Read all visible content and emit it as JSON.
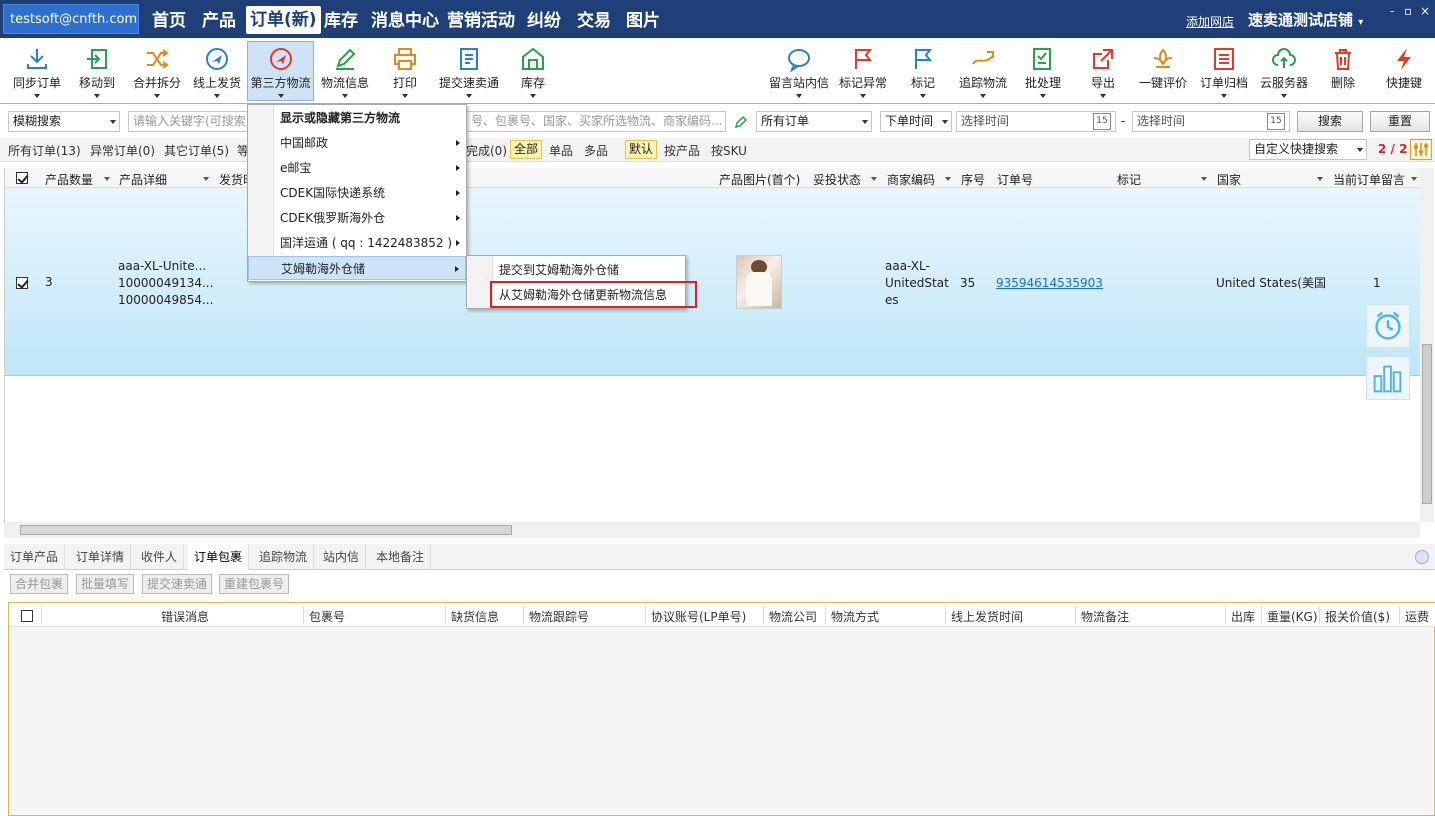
{
  "topbar": {
    "account": "testsoft@cnfth.com",
    "nav": [
      "首页",
      "产品",
      "订单(新)",
      "库存",
      "消息中心",
      "营销活动",
      "纠纷",
      "交易",
      "图片"
    ],
    "add_shop": "添加网店",
    "shop_name": "速卖通测试店铺",
    "win_min": "-",
    "win_max": "▫",
    "win_close": "×"
  },
  "toolbar": {
    "left": [
      "同步订单",
      "移动到",
      "合并拆分",
      "线上发货",
      "第三方物流",
      "物流信息",
      "打印",
      "提交速卖通",
      "库存"
    ],
    "right": [
      "留言站内信",
      "标记异常",
      "标记",
      "追踪物流",
      "批处理",
      "导出",
      "一键评价",
      "订单归档",
      "云服务器",
      "删除",
      "快捷键"
    ]
  },
  "filter": {
    "mode": "模糊搜索",
    "keyword_placeholder": "请输入关键字(可搜索",
    "keyword_hint": "号、包裹号、国家、买家所选物流、商家编码...",
    "order_type": "所有订单",
    "time_type": "下单时间",
    "start_placeholder": "选择时间",
    "dash": "-",
    "end_placeholder": "选择时间",
    "cal": "15",
    "search": "搜索",
    "reset": "重置"
  },
  "tabs": {
    "all": "所有订单(13)",
    "abnormal": "异常订单(0)",
    "other": "其它订单(5)",
    "wait": "等",
    "done": "完成(0)",
    "pills": [
      "全部",
      "单品",
      "多品"
    ],
    "pills2": [
      "默认",
      "按产品",
      "按SKU"
    ],
    "quick_search": "自定义快捷搜索",
    "page": "2 / 2"
  },
  "grid": {
    "headers": [
      "产品数量",
      "产品详细",
      "发货时",
      "产品图片(首个)",
      "妥投状态",
      "商家编码",
      "序号",
      "订单号",
      "标记",
      "国家",
      "当前订单留言"
    ],
    "row": {
      "qty": "3",
      "detail": [
        "aaa-XL-Unite...",
        "10000049134...",
        "10000049854..."
      ],
      "sku": [
        "aaa-XL-",
        "UnitedStat",
        "es"
      ],
      "seq": "35",
      "order_no": "93594614535903",
      "country": "United States(美国",
      "msg": "1"
    }
  },
  "menu": {
    "items": [
      "显示或隐藏第三方物流",
      "中国邮政",
      "e邮宝",
      "CDEK国际快递系统",
      "CDEK俄罗斯海外仓",
      "国洋运通 ( qq : 1422483852 )",
      "艾姆勒海外仓储"
    ],
    "submenu": [
      "提交到艾姆勒海外仓储",
      "从艾姆勒海外仓储更新物流信息"
    ]
  },
  "bottom": {
    "tabs": [
      "订单产品",
      "订单详情",
      "收件人",
      "订单包裹",
      "追踪物流",
      "站内信",
      "本地备注"
    ],
    "buttons": [
      "合并包裹",
      "批量填写",
      "提交速卖通",
      "重建包裹号"
    ],
    "headers": [
      "错误消息",
      "包裹号",
      "缺货信息",
      "物流跟踪号",
      "协议账号(LP单号)",
      "物流公司",
      "物流方式",
      "线上发货时间",
      "物流备注",
      "出库",
      "重量(KG)",
      "报关价值($)",
      "运费"
    ]
  },
  "colors": {
    "topbar": "#1e3f78",
    "accent": "#2e6fd0",
    "highlight": "#e02020"
  }
}
